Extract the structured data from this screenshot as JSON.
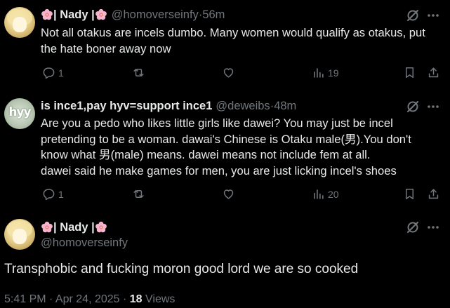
{
  "tweets": [
    {
      "display_name": "| Nady |",
      "handle": "@homoverseinfy",
      "separator": " · ",
      "time": "56m",
      "lines": [
        "Not all otakus are incels dumbo. Many women would qualify as otakus, put",
        "the hate boner away now"
      ],
      "replies": "1",
      "reposts": "",
      "likes": "",
      "views": "19"
    },
    {
      "display_name": "is ince1,pay hyv=support ince1",
      "handle": "@deweibs",
      "separator": " · ",
      "time": "48m",
      "avatar_text": "hyy",
      "lines": [
        "Are you a pedo who likes little girls like dawei? You may just be incel",
        "pretending to be a woman. dawai's Chinese is Otaku male(男).You don't",
        "know what 男(male) means. dawei means not include fem at all.",
        "dawei said he make games for men, you are just licking incel's shoes"
      ],
      "replies": "1",
      "reposts": "",
      "likes": "",
      "views": "20"
    }
  ],
  "main": {
    "display_name": "| Nady |",
    "handle": "@homoverseinfy",
    "text": "Transphobic and fucking moron good lord we are so cooked",
    "time": "5:41 PM · Apr 24, 2025 · ",
    "views_count": "18",
    "views_label": " Views"
  },
  "colors": {
    "background": "#000000",
    "text": "#e7e9ea",
    "muted": "#71767b",
    "divider": "#2f3336",
    "flower": "#f4a7c4"
  },
  "icons": [
    "flower-emoji",
    "grok-icon",
    "more-icon",
    "reply-icon",
    "repost-icon",
    "like-icon",
    "views-icon",
    "bookmark-icon",
    "share-icon"
  ]
}
